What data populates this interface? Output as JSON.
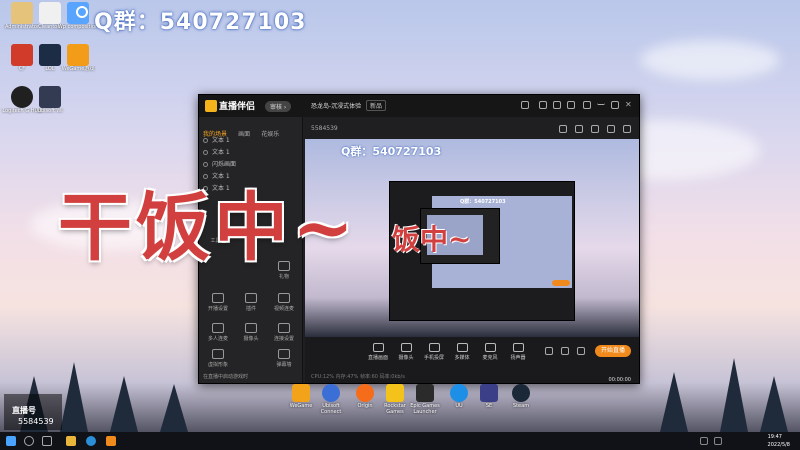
{
  "banner": {
    "qq_group": "Q群：540727103"
  },
  "overlay": {
    "caption": "干饭中~",
    "caption_small": "饭中~"
  },
  "desktop_icons": [
    {
      "label": "Administrator"
    },
    {
      "label": "Cleantool"
    },
    {
      "label": "Wp composition"
    },
    {
      "label": "CF"
    },
    {
      "label": "LOL"
    },
    {
      "label": "WeGame游戏"
    },
    {
      "label": "Logitech G HUB"
    },
    {
      "label": "Ubisoft Wi"
    }
  ],
  "app": {
    "name": "直播伴侣",
    "badge": "审核 ›",
    "session_title": "恐龙岛-沉浸式体验",
    "session_tag": "新品",
    "tabs": [
      "我的场景",
      "画面",
      "花娱乐"
    ],
    "scenes": [
      "文本 1",
      "文本 1",
      "闪烁画面",
      "文本 1",
      "文本 1"
    ],
    "toolbar_id": "5584539",
    "preview_qq": "Q群：540727103",
    "sidebar_grid": [
      {
        "label": "工具箱"
      },
      {
        "label": "礼物"
      },
      {
        "label": "开播设置"
      },
      {
        "label": "插件"
      },
      {
        "label": "视频连麦"
      },
      {
        "label": "多人连麦"
      },
      {
        "label": "摄像头"
      },
      {
        "label": "连接设置"
      },
      {
        "label": "虚拟形象"
      },
      {
        "label": "弹幕墙"
      }
    ],
    "sidebar_note": "在直播中启动游戏时",
    "bottom_buttons": [
      {
        "label": "直播画面"
      },
      {
        "label": "摄像头"
      },
      {
        "label": "手机投屏"
      },
      {
        "label": "多媒体"
      },
      {
        "label": "麦克风"
      },
      {
        "label": "扬声器"
      }
    ],
    "start_live": "开始直播",
    "status_text": "CPU:12%  内存:47%  帧率:60  码率:0kb/s",
    "timer": "00:00:00"
  },
  "launchers": [
    {
      "label": "WeGame",
      "color": "#f2a31a"
    },
    {
      "label": "Ubisoft Connect",
      "color": "#3c6fd6"
    },
    {
      "label": "Origin",
      "color": "#f56c1a"
    },
    {
      "label": "Rockstar Games",
      "color": "#f3c21b"
    },
    {
      "label": "Epic Games Launcher",
      "color": "#2b2b2b"
    },
    {
      "label": "UU",
      "color": "#1e8fe6"
    },
    {
      "label": "SE",
      "color": "#3b3f88"
    },
    {
      "label": "Steam",
      "color": "#1b2838"
    }
  ],
  "streamer": {
    "name": "直播号",
    "id": "5584539"
  },
  "clock": {
    "time": "19:47",
    "date": "2022/5/8"
  }
}
